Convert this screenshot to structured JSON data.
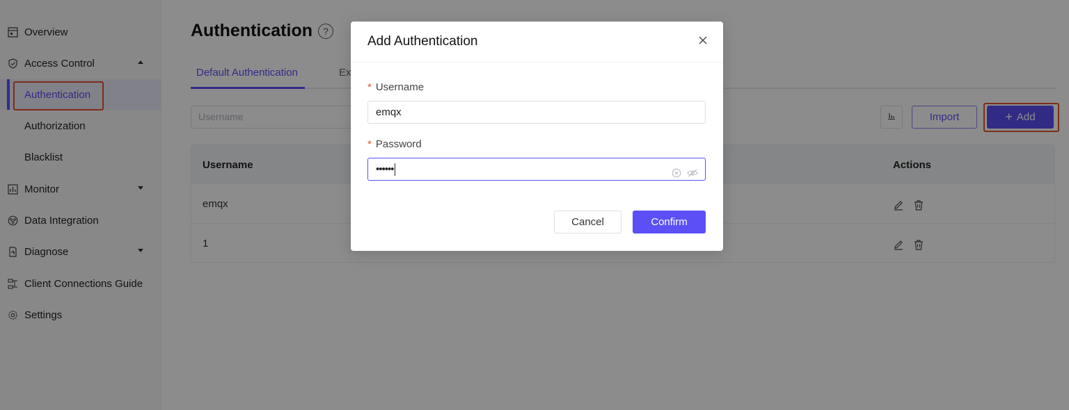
{
  "sidebar": {
    "items": [
      {
        "label": "Overview",
        "icon": "overview-icon"
      },
      {
        "label": "Access Control",
        "icon": "shield-icon"
      },
      {
        "label": "Monitor",
        "icon": "monitor-icon"
      },
      {
        "label": "Data Integration",
        "icon": "data-integration-icon"
      },
      {
        "label": "Diagnose",
        "icon": "diagnose-icon"
      },
      {
        "label": "Client Connections Guide",
        "icon": "client-guide-icon"
      },
      {
        "label": "Settings",
        "icon": "gear-icon"
      }
    ],
    "access_control_sub": [
      {
        "label": "Authentication",
        "active": true
      },
      {
        "label": "Authorization",
        "active": false
      },
      {
        "label": "Blacklist",
        "active": false
      }
    ]
  },
  "page": {
    "title": "Authentication",
    "tabs": [
      {
        "label": "Default Authentication",
        "active": true
      },
      {
        "label": "Ex",
        "active": false
      }
    ],
    "search": {
      "placeholder": "Username"
    },
    "import_label": "Import",
    "add_label": "Add"
  },
  "table": {
    "headers": {
      "username": "Username",
      "actions": "Actions"
    },
    "rows": [
      {
        "username": "emqx"
      },
      {
        "username": "1"
      }
    ]
  },
  "dialog": {
    "title": "Add Authentication",
    "username_label": "Username",
    "username_value": "emqx",
    "password_label": "Password",
    "password_value": "••••••",
    "cancel_label": "Cancel",
    "confirm_label": "Confirm"
  },
  "colors": {
    "accent": "#5b4ff5",
    "highlight": "#e5532f",
    "overlay": "rgba(0,0,0,0.45)"
  }
}
